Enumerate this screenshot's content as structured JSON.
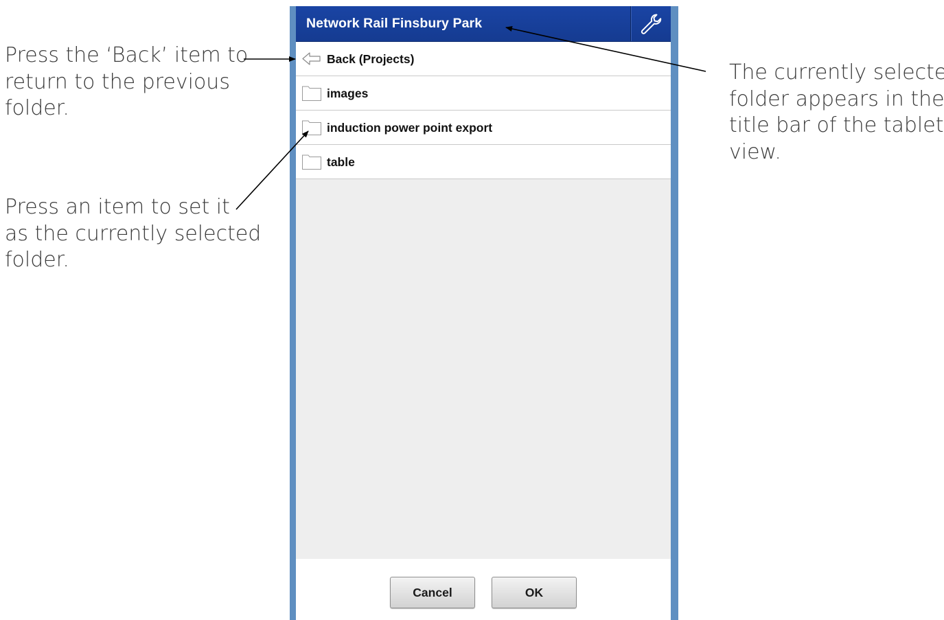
{
  "annotations": {
    "back_help": [
      "Press the ‘Back’ item to",
      "return to the previous",
      "folder."
    ],
    "item_help": [
      "Press an item to set it",
      "as the currently selected",
      "folder."
    ],
    "title_help": [
      "The currently selected",
      "folder appears in the",
      "title bar of the tablet",
      "view."
    ]
  },
  "tablet": {
    "title": "Network Rail Finsbury Park",
    "settings_icon": "wrench-icon",
    "items": [
      {
        "label": "Back (Projects)",
        "icon": "back-arrow-icon"
      },
      {
        "label": "images",
        "icon": "folder-icon"
      },
      {
        "label": "induction power point export",
        "icon": "folder-icon"
      },
      {
        "label": "table",
        "icon": "folder-icon"
      }
    ],
    "buttons": {
      "cancel": "Cancel",
      "ok": "OK"
    }
  },
  "colors": {
    "title_bar": "#1a44a4",
    "frame": "#5f8fc1",
    "list_background": "#eeeeee",
    "annotation_text": "#3a3a3a"
  }
}
